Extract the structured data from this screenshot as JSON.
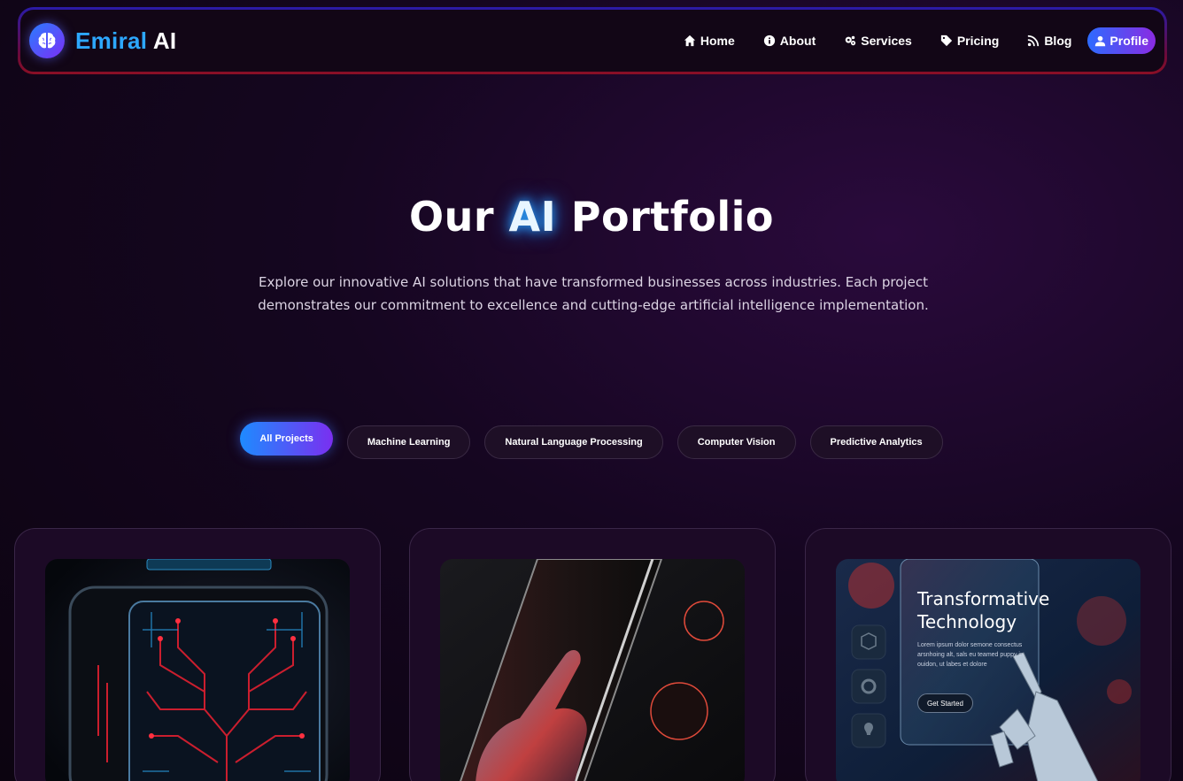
{
  "brand": {
    "name_accent": "Emiral",
    "name_rest": "AI",
    "logo_icon": "brain-icon"
  },
  "nav": {
    "items": [
      {
        "label": "Home",
        "icon": "home-icon"
      },
      {
        "label": "About",
        "icon": "info-icon"
      },
      {
        "label": "Services",
        "icon": "cogs-icon"
      },
      {
        "label": "Pricing",
        "icon": "tag-icon"
      },
      {
        "label": "Blog",
        "icon": "rss-icon"
      }
    ],
    "profile_label": "Profile"
  },
  "hero": {
    "title_pre": "Our ",
    "title_accent": "AI",
    "title_post": " Portfolio",
    "description": "Explore our innovative AI solutions that have transformed businesses across industries. Each project demonstrates our commitment to excellence and cutting-edge artificial intelligence implementation."
  },
  "filters": [
    {
      "label": "All Projects",
      "active": true
    },
    {
      "label": "Machine Learning",
      "active": false
    },
    {
      "label": "Natural Language Processing",
      "active": false
    },
    {
      "label": "Computer Vision",
      "active": false
    },
    {
      "label": "Predictive Analytics",
      "active": false
    }
  ],
  "cards": [
    {
      "image": "ai-chip-circuit-image"
    },
    {
      "image": "hand-touching-phone-image"
    },
    {
      "image": "robot-hand-transformative-technology-image",
      "overlay_title_1": "Transformative",
      "overlay_title_2": "Technology",
      "overlay_body": "Lorem ipsum dolor semone consectus arsnhoing alt, sals eu teamed puppy in ouidon, ut labes et dolore",
      "overlay_button": "Get Started"
    }
  ],
  "colors": {
    "accent_blue": "#2da8ff",
    "accent_purple": "#7a2ff0",
    "card_bg": "#1c0a26"
  }
}
